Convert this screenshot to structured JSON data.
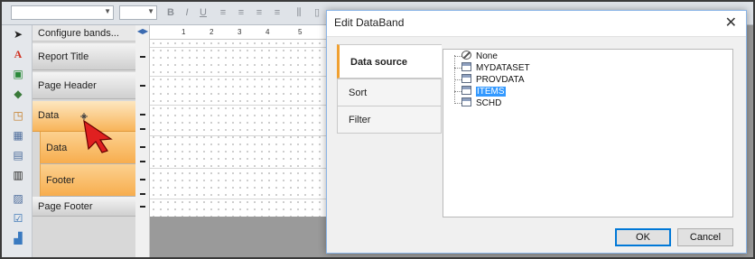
{
  "dialog": {
    "title": "Edit DataBand",
    "tabs": [
      {
        "label": "Data source",
        "active": true
      },
      {
        "label": "Sort",
        "active": false
      },
      {
        "label": "Filter",
        "active": false
      }
    ],
    "tree": [
      {
        "label": "None",
        "icon": "none-icon",
        "selected": false
      },
      {
        "label": "MYDATASET",
        "icon": "table-icon",
        "selected": false
      },
      {
        "label": "PROVDATA",
        "icon": "table-icon",
        "selected": false
      },
      {
        "label": "ITEMS",
        "icon": "table-icon",
        "selected": true
      },
      {
        "label": "SCHD",
        "icon": "table-icon",
        "selected": false
      }
    ],
    "ok_label": "OK",
    "cancel_label": "Cancel"
  },
  "bands_panel": {
    "title": "Configure bands...",
    "bands": [
      {
        "label": "Report Title"
      },
      {
        "label": "Page Header"
      },
      {
        "label": "Data"
      },
      {
        "label": "Data"
      },
      {
        "label": "Footer"
      },
      {
        "label": "Page Footer"
      }
    ]
  },
  "ruler": {
    "ticks": [
      "1",
      "2",
      "3",
      "4",
      "5"
    ]
  },
  "colors": {
    "band_highlight": "#f8b459",
    "selection": "#3399ff",
    "dialog_accent": "#f0a030"
  }
}
